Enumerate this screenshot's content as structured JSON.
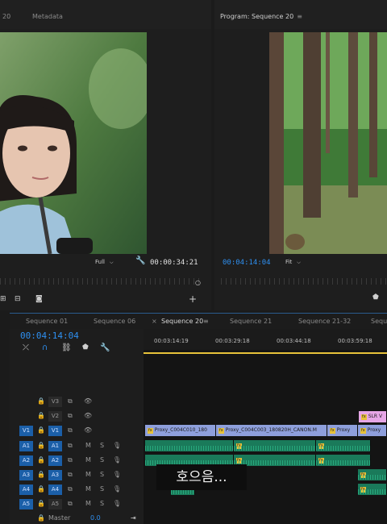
{
  "source_monitor": {
    "tab_number": "20",
    "tab_metadata": "Metadata",
    "zoom_select": "Full",
    "timecode": "00:00:34:21"
  },
  "program_monitor": {
    "tab_title": "Program: Sequence 20",
    "menu_icon": "≡",
    "timecode": "00:04:14:04",
    "zoom_select": "Fit"
  },
  "timeline": {
    "tabs": [
      "Sequence 01",
      "Sequence 06",
      "Sequence 20",
      "Sequence 21",
      "Sequence 21-32",
      "Seque"
    ],
    "active_tab": "Sequence 20",
    "playhead_timecode": "00:04:14:04",
    "ruler_labels": [
      "00:03:14:19",
      "00:03:29:18",
      "00:03:44:18",
      "00:03:59:18"
    ],
    "video_tracks": [
      {
        "target": "",
        "label": "V3"
      },
      {
        "target": "",
        "label": "V2"
      },
      {
        "target": "V1",
        "label": "V1"
      }
    ],
    "audio_tracks": [
      {
        "target": "A1",
        "label": "A1",
        "m": "M",
        "s": "S"
      },
      {
        "target": "A2",
        "label": "A2",
        "m": "M",
        "s": "S"
      },
      {
        "target": "A3",
        "label": "A3",
        "m": "M",
        "s": "S"
      },
      {
        "target": "A4",
        "label": "A4",
        "m": "M",
        "s": "S"
      },
      {
        "target": "A5",
        "label": "A5",
        "m": "M",
        "s": "S"
      }
    ],
    "master_label": "Master",
    "master_value": "0.0",
    "clips": {
      "v1_clip1": "Proxy_C004C010_180",
      "v1_clip2": "Proxy_C004C003_180820H_CANON.M",
      "v1_clip3": "Proxy",
      "v1_clip4": "Proxy",
      "v2_clip": "SLR V",
      "fx": "fx"
    }
  },
  "subtitle_overlay": "호으음..."
}
